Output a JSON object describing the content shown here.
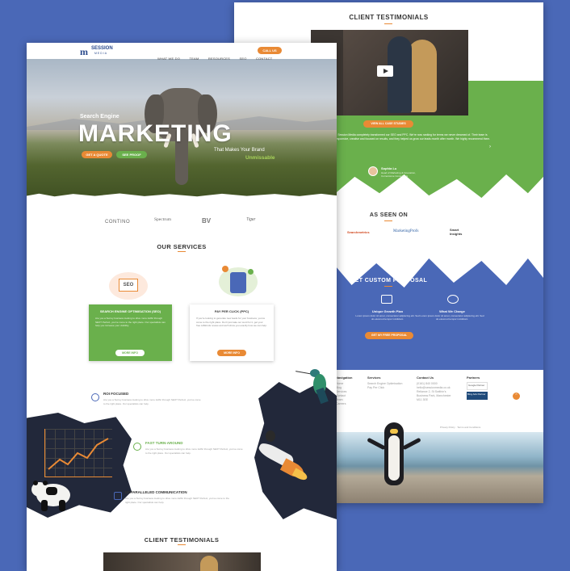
{
  "back_page": {
    "testimonials_title": "CLIENT TESTIMONIALS",
    "case_studies_button": "VIEW ALL CASE STUDIES",
    "quote": "Session Media completely transformed our SEO and PPC. We're now ranking for terms we never dreamed of. Their team is responsive, creative and focused on results, and they helped us grow our leads month after month. We highly recommend them.",
    "author_name": "Sophia Lu",
    "author_role": "Head of Marketing & Innovation, Cornerstone Consultants",
    "as_seen_on_title": "AS SEEN ON",
    "press_logos": [
      "Searchmetrics",
      "MarketingProfs",
      "Smart Insights"
    ],
    "proposal_title": "GET CUSTOM PROPOSAL",
    "proposal_steps": [
      {
        "title": "Unique Growth Plan",
        "text": "Lorem ipsum dolor sit amet, consectetur adipiscing elit. Sed do eiusmod tempor incididunt."
      },
      {
        "title": "What We Charge",
        "text": "Lorem ipsum dolor sit amet, consectetur adipiscing elit. Sed do eiusmod tempor incididunt."
      }
    ],
    "proposal_button": "GET MY FREE PROPOSAL",
    "footer": {
      "col_navigation": "Navigation",
      "nav_links": [
        "Home",
        "Blog",
        "Services",
        "Contact",
        "Team",
        "Careers"
      ],
      "col_services": "Services",
      "service_links": [
        "Search Engine Optimisation",
        "Pay Per Click"
      ],
      "col_contact": "Contact Us",
      "phone": "(0161) 840 0000",
      "email": "hello@sessionmedia.co.uk",
      "address": "Reliance 2, St Swithin's Business Park, Manchester M11 3EE",
      "col_partners": "Partners",
      "partner_badges": [
        "Google Partner",
        "Bing Ads Partner"
      ],
      "legal": "Privacy Policy  ·  Terms and Conditions"
    }
  },
  "front_page": {
    "logo_main": "SESSION",
    "logo_sub": "MEDIA",
    "nav": [
      "WHAT WE DO",
      "TEAM",
      "RESOURCES",
      "SEO",
      "CONTACT"
    ],
    "nav_cta": "CALL US",
    "hero_kicker": "Search Engine",
    "hero_headline": "MARKETING",
    "hero_tagline": "That Makes Your Brand",
    "hero_highlight": "Unmissable",
    "hero_btn_1": "GET A QUOTE",
    "hero_btn_2": "SEE PROOF",
    "client_logos": [
      "CONTINO",
      "Spectrum",
      "BV",
      "Tiger"
    ],
    "services_title": "OUR SERVICES",
    "services": [
      {
        "title": "SEARCH ENGINE OPTIMISATION (SEO)",
        "text": "Are you a Surrey business looking to drive more traffic through SEO? Perfect, you've come to the right place. Our specialists can help you increase your visibility.",
        "button": "MORE INFO"
      },
      {
        "title": "PAY PER CLICK (PPC)",
        "text": "If you're looking to generate new leads for your business, you've come to the right place. Don't just take our word for it, get your free AdWords review and we'll show you exactly how we can help.",
        "button": "MORE INFO"
      }
    ],
    "features": [
      {
        "title": "ROI FOCUSED",
        "text": "Are you a Surrey business looking to drive more traffic through SEO? Perfect, you've come to the right place. Our specialists can help."
      },
      {
        "title": "FAST TURN-AROUND",
        "text": "Are you a Surrey business looking to drive more traffic through SEO? Perfect, you've come to the right place. Our specialists can help."
      },
      {
        "title": "UNPARALLELED COMMUNICATION",
        "text": "Are you a Surrey business looking to drive more traffic through SEO? Perfect, you've come to the right place. Our specialists can help."
      }
    ],
    "testimonials_title": "CLIENT TESTIMONIALS",
    "seo_badge": "SEO"
  },
  "colors": {
    "background": "#4a68b7",
    "orange": "#e98a35",
    "green": "#6ab04c",
    "blue_band": "#4a68b7"
  }
}
